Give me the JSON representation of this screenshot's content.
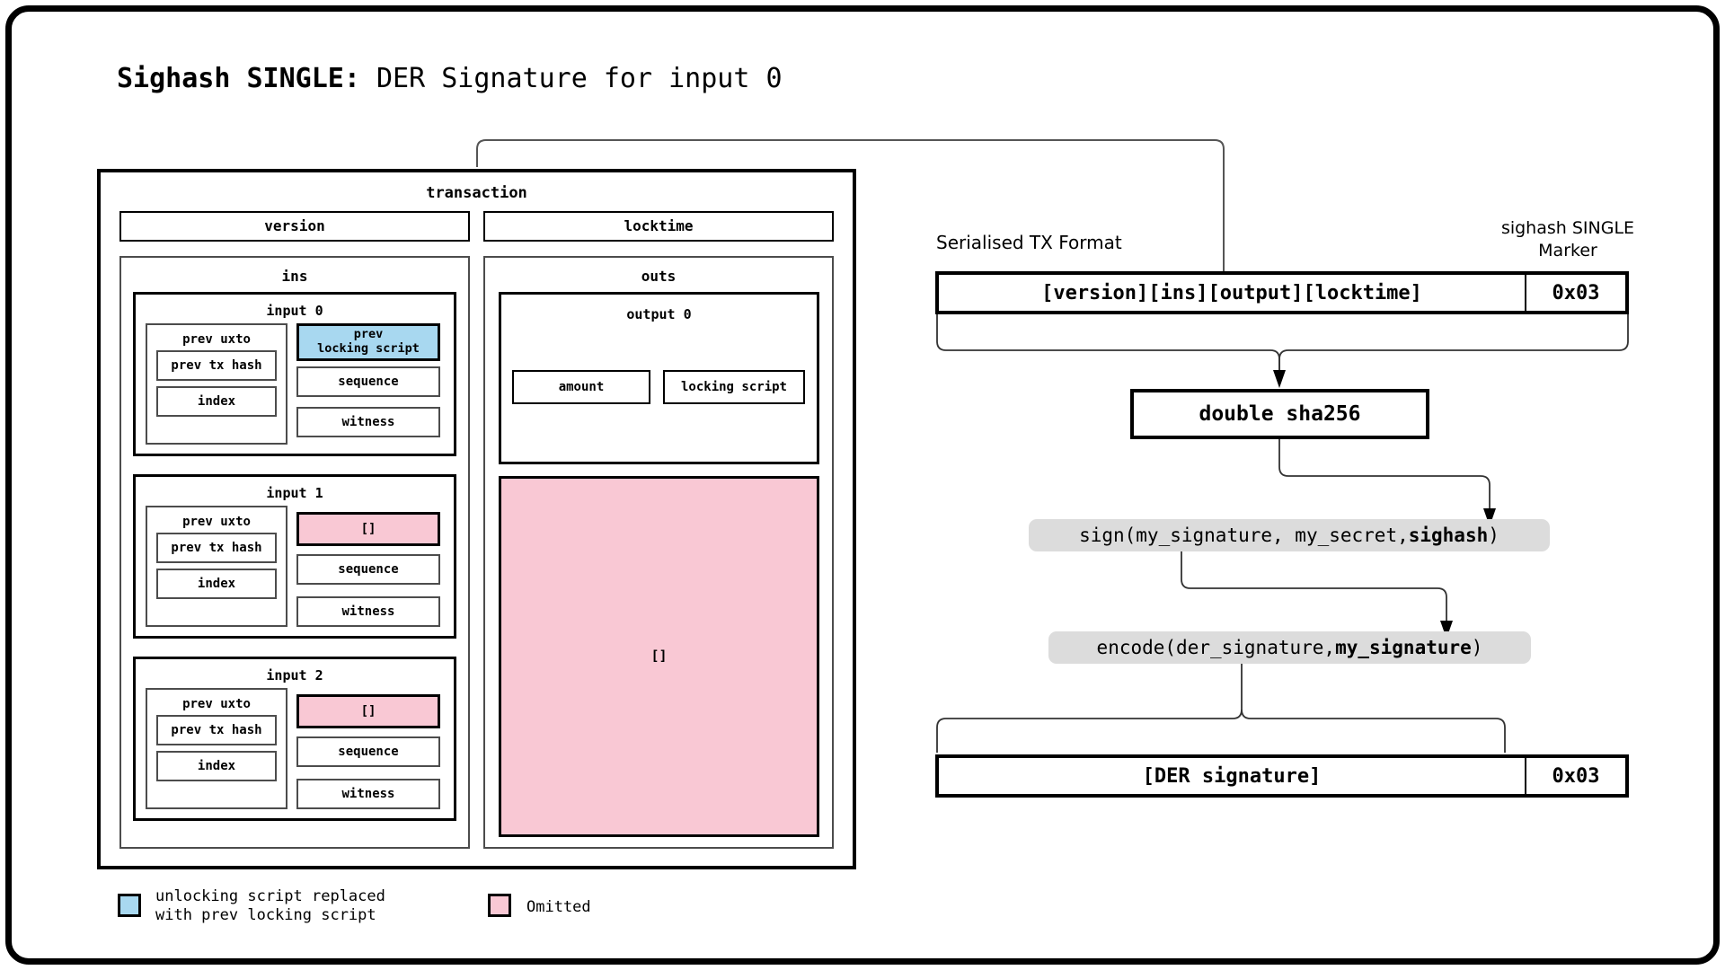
{
  "title": {
    "bold_part": "Sighash SINGLE:",
    "rest_part": " DER Signature for input 0"
  },
  "transaction": {
    "label": "transaction",
    "version_label": "version",
    "locktime_label": "locktime",
    "ins": {
      "label": "ins",
      "inputs": [
        {
          "label": "input 0",
          "prev_uxto_label": "prev uxto",
          "prev_tx_hash_label": "prev tx hash",
          "index_label": "index",
          "script_label": "prev\nlocking script",
          "script_state": "replaced",
          "sequence_label": "sequence",
          "witness_label": "witness"
        },
        {
          "label": "input 1",
          "prev_uxto_label": "prev uxto",
          "prev_tx_hash_label": "prev tx hash",
          "index_label": "index",
          "script_label": "[]",
          "script_state": "omitted",
          "sequence_label": "sequence",
          "witness_label": "witness"
        },
        {
          "label": "input 2",
          "prev_uxto_label": "prev uxto",
          "prev_tx_hash_label": "prev tx hash",
          "index_label": "index",
          "script_label": "[]",
          "script_state": "omitted",
          "sequence_label": "sequence",
          "witness_label": "witness"
        }
      ]
    },
    "outs": {
      "label": "outs",
      "output0": {
        "label": "output 0",
        "amount_label": "amount",
        "locking_script_label": "locking script"
      },
      "omitted_label": "[]"
    }
  },
  "flow": {
    "serialised_tx_caption": "Serialised TX Format",
    "marker_caption_line1": "sighash SINGLE",
    "marker_caption_line2": "Marker",
    "serialised_box": {
      "main": "[version][ins][output][locktime]",
      "marker": "0x03"
    },
    "hash_box_label": "double sha256",
    "sign_pill": {
      "prefix": "sign(my_signature, my_secret, ",
      "bold": "sighash",
      "suffix": ")"
    },
    "encode_pill": {
      "prefix": "encode(der_signature, ",
      "bold": "my_signature",
      "suffix": ")"
    },
    "result_box": {
      "main": "[DER signature]",
      "marker": "0x03"
    }
  },
  "legend": {
    "items": [
      {
        "color": "#a8d8f0",
        "text": "unlocking script replaced\nwith prev locking script"
      },
      {
        "color": "#f9c8d4",
        "text": "Omitted"
      }
    ]
  },
  "colors": {
    "replaced": "#a8d8f0",
    "omitted": "#f9c8d4",
    "stroke": "#000000",
    "pill_bg": "#dcdcdc"
  }
}
